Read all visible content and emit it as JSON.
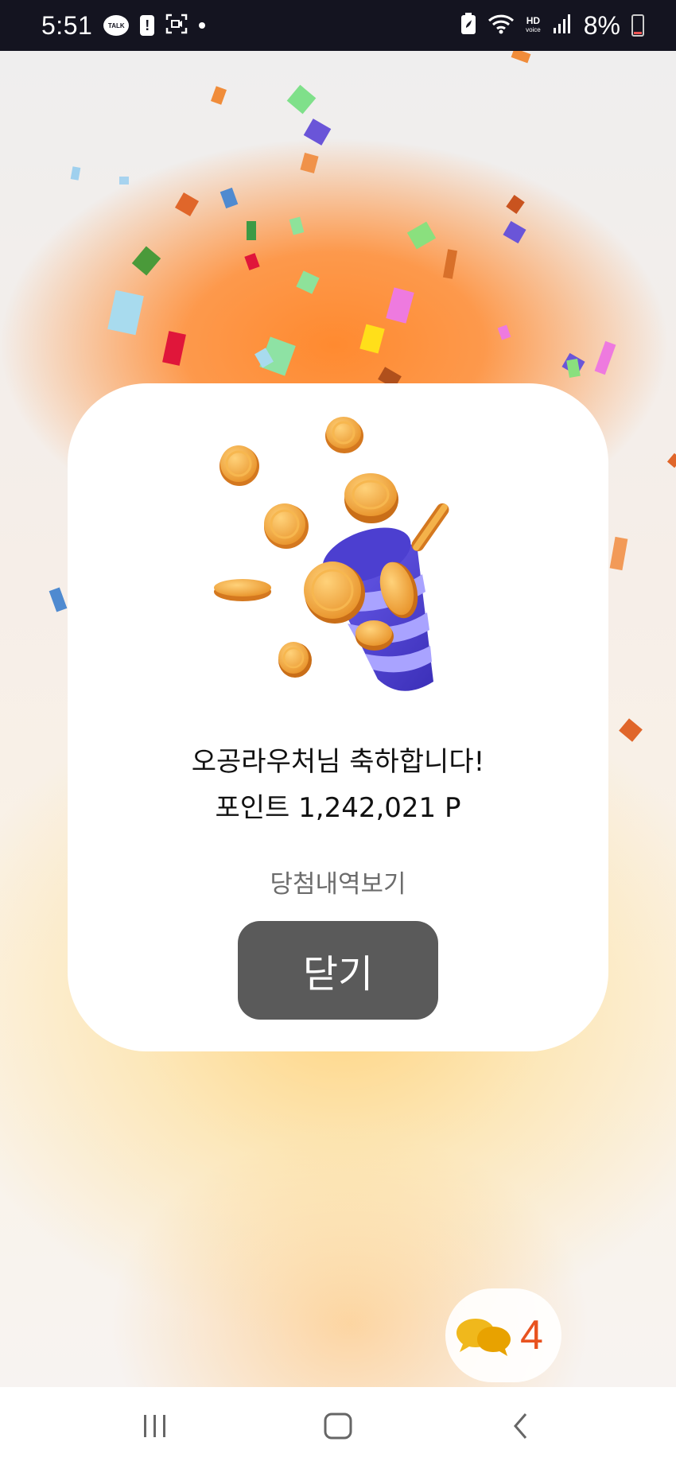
{
  "status_bar": {
    "time": "5:51",
    "talk_label": "TALK",
    "battery_percent": "8%",
    "hd_label": "HD",
    "voice_label": "voice"
  },
  "modal": {
    "greeting": "오공라우처님 축하합니다!",
    "points": "포인트 1,242,021 P",
    "history_link": "당첨내역보기",
    "close_label": "닫기"
  },
  "chat_fab": {
    "count": "4"
  },
  "colors": {
    "accent_orange": "#ff8a30",
    "close_button": "#5a5a5a",
    "chat_count": "#e8521f",
    "coin": "#f0a93a",
    "party_horn": "#5b4bd8"
  },
  "icons": {
    "status": [
      "kakaotalk-icon",
      "alert-icon",
      "screen-record-icon",
      "battery-saver-icon",
      "wifi-icon",
      "signal-icon",
      "battery-icon"
    ],
    "nav": [
      "recent-apps-icon",
      "home-icon",
      "back-icon"
    ],
    "fab": "chat-bubbles-icon"
  }
}
